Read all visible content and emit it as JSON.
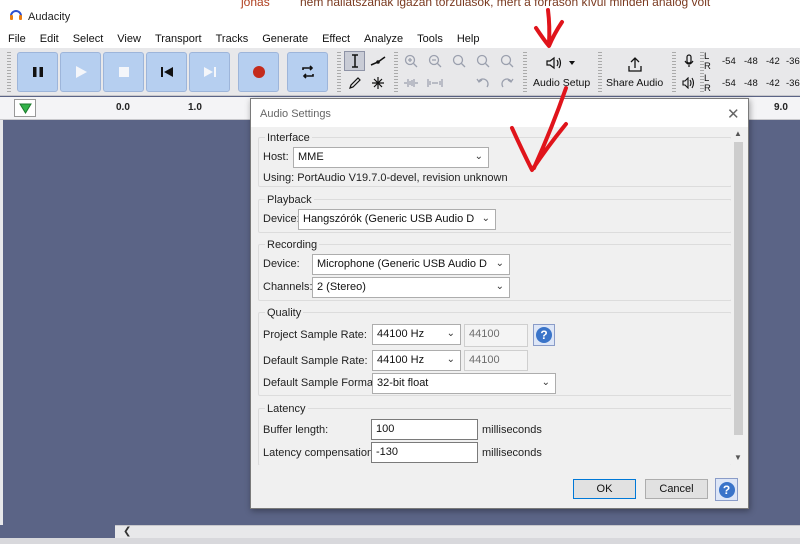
{
  "window": {
    "title": "Audacity",
    "bg_text_left": "jonas",
    "bg_text_right": "nem hallatszanak igazán torzulások, mert a forráson kívül minden analóg volt"
  },
  "menu": [
    "File",
    "Edit",
    "Select",
    "View",
    "Transport",
    "Tracks",
    "Generate",
    "Effect",
    "Analyze",
    "Tools",
    "Help"
  ],
  "toolbar": {
    "transport_icons": [
      "pause-icon",
      "play-icon",
      "stop-icon",
      "skip-start-icon",
      "skip-end-icon",
      "record-icon",
      "loop-icon"
    ],
    "audio_setup_label": "Audio Setup",
    "share_audio_label": "Share Audio",
    "meter": {
      "rec_channels": [
        "L",
        "R"
      ],
      "play_channels": [
        "L",
        "R"
      ],
      "scale": [
        "-54",
        "-48",
        "-42",
        "-36"
      ]
    }
  },
  "ruler": {
    "ticks": [
      "0.0",
      "1.0",
      "9.0"
    ]
  },
  "dialog": {
    "title": "Audio Settings",
    "close": "✕",
    "interface": {
      "title": "Interface",
      "host_label": "Host:",
      "host_value": "MME",
      "using_text": "Using: PortAudio V19.7.0-devel, revision unknown"
    },
    "playback": {
      "title": "Playback",
      "device_label": "Device:",
      "device_value": "Hangszórók (Generic USB Audio D"
    },
    "recording": {
      "title": "Recording",
      "device_label": "Device:",
      "device_value": "Microphone (Generic USB Audio D",
      "channels_label": "Channels:",
      "channels_value": "2 (Stereo)"
    },
    "quality": {
      "title": "Quality",
      "project_rate_label": "Project Sample Rate:",
      "project_rate_value": "44100 Hz",
      "project_rate_custom": "44100",
      "default_rate_label": "Default Sample Rate:",
      "default_rate_value": "44100 Hz",
      "default_rate_custom": "44100",
      "format_label": "Default Sample Format:",
      "format_value": "32-bit float"
    },
    "latency": {
      "title": "Latency",
      "buffer_label": "Buffer length:",
      "buffer_value": "100",
      "buffer_unit": "milliseconds",
      "comp_label": "Latency compensation:",
      "comp_value": "-130",
      "comp_unit": "milliseconds"
    },
    "ok_label": "OK",
    "cancel_label": "Cancel",
    "help_glyph": "?"
  },
  "colors": {
    "track_bg": "#5b6486",
    "transport_button": "#b6cff0",
    "annotation": "#e0141b",
    "help_blue": "#3a74c9"
  }
}
